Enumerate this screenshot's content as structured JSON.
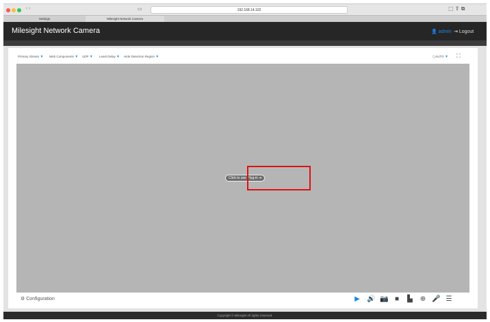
{
  "browser": {
    "url": "192.168.14.102",
    "tabs": [
      "Settings",
      "Milesight Network Camera"
    ]
  },
  "header": {
    "title": "Milesight Network Camera",
    "user": "admin",
    "logout": "Logout"
  },
  "options": [
    "Primary Stream",
    "Web Components",
    "UDP",
    "Least Delay",
    "Hide Detection Region"
  ],
  "zoom_mode": "AUTO",
  "video": {
    "plugin_prompt": "Click to use Plug-in"
  },
  "config_label": "Configuration",
  "footer": "Copyright © Milesight All rights reserved.",
  "colors": {
    "accent": "#1e88e5",
    "header": "#262626",
    "highlight": "#e01010"
  }
}
